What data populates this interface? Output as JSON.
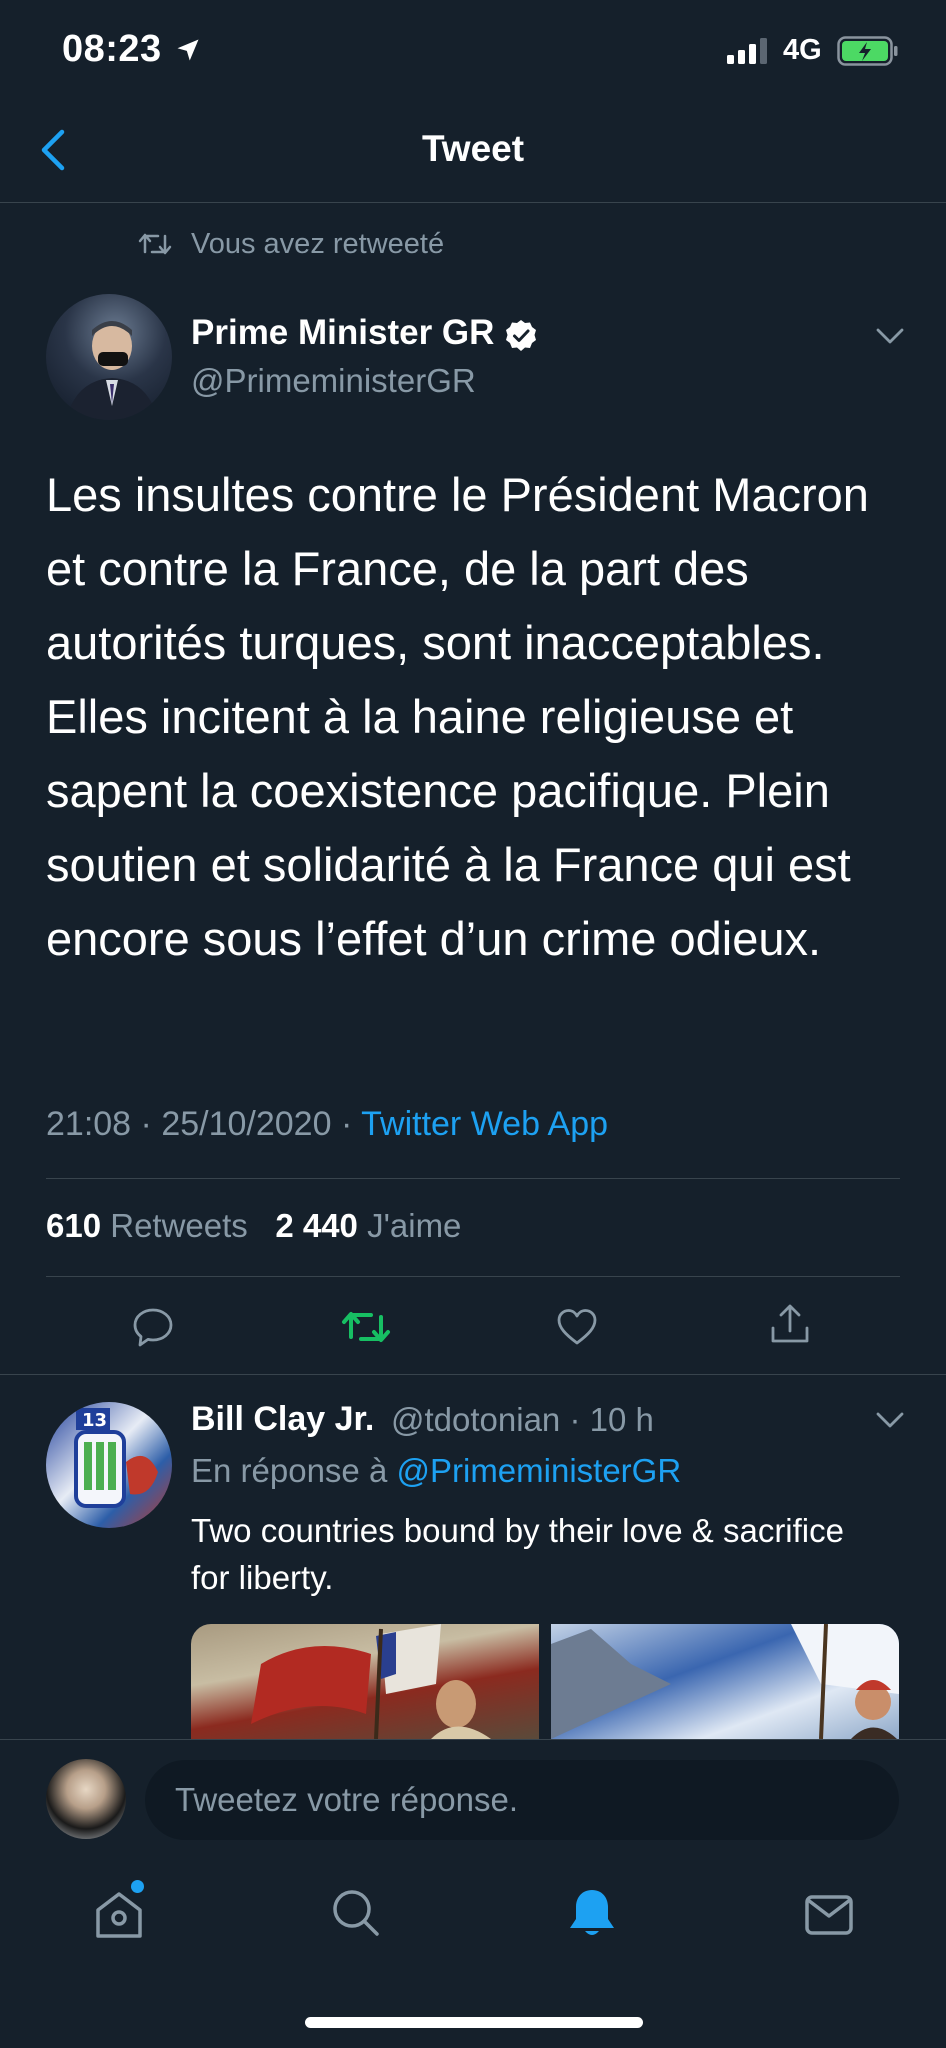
{
  "status_bar": {
    "time": "08:23",
    "network": "4G"
  },
  "header": {
    "title": "Tweet"
  },
  "context": {
    "retweet_text": "Vous avez retweeté"
  },
  "tweet": {
    "author_name": "Prime Minister GR",
    "author_handle": "@PrimeministerGR",
    "text": "Les insultes contre le Président Macron et contre la France, de la part des autorités turques, sont inacceptables. Elles incitent à la haine religieuse et sapent la coexistence pacifique. Plein soutien et solidarité à la France qui est encore sous l’effet d’un crime odieux.",
    "time": "21:08",
    "date": "25/10/2020",
    "source": "Twitter Web App",
    "retweets_count": "610",
    "retweets_label": "Retweets",
    "likes_count": "2 440",
    "likes_label": "J'aime"
  },
  "reply": {
    "author_name": "Bill Clay Jr.",
    "author_handle": "@tdotonian",
    "time_ago": "10 h",
    "in_reply_prefix": "En réponse à",
    "in_reply_mention": "@PrimeministerGR",
    "text": "Two countries bound by their love & sacrifice for liberty."
  },
  "composer": {
    "placeholder": "Tweetez votre réponse."
  },
  "colors": {
    "background": "#15202b",
    "accent": "#1da1f2",
    "retweet_active": "#17bf63",
    "muted": "#8899a6",
    "divider": "#38444d"
  },
  "icons": {
    "back": "chevron-left-icon",
    "retweet": "retweet-icon",
    "verified": "verified-badge-icon",
    "more": "chevron-down-icon",
    "reply": "comment-icon",
    "like": "heart-icon",
    "share": "share-icon",
    "home": "home-icon",
    "search": "search-icon",
    "notifications": "bell-icon",
    "messages": "mail-icon"
  }
}
